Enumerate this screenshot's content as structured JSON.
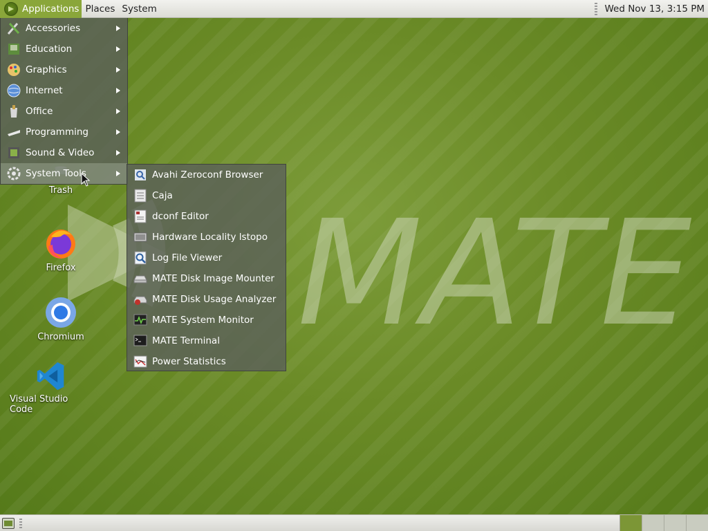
{
  "top_panel": {
    "menus": [
      "Applications",
      "Places",
      "System"
    ],
    "clock": "Wed Nov 13,  3:15 PM"
  },
  "desktop": {
    "logo_text": "MATE",
    "icons": [
      {
        "label": "Trash",
        "icon": "trash-icon"
      },
      {
        "label": "Firefox",
        "icon": "firefox-icon"
      },
      {
        "label": "Chromium",
        "icon": "chromium-icon"
      },
      {
        "label": "Visual Studio Code",
        "icon": "vscode-icon"
      }
    ]
  },
  "applications_menu": {
    "items": [
      {
        "label": "Accessories",
        "icon": "accessories-icon"
      },
      {
        "label": "Education",
        "icon": "education-icon"
      },
      {
        "label": "Graphics",
        "icon": "graphics-icon"
      },
      {
        "label": "Internet",
        "icon": "internet-icon"
      },
      {
        "label": "Office",
        "icon": "office-icon"
      },
      {
        "label": "Programming",
        "icon": "programming-icon"
      },
      {
        "label": "Sound & Video",
        "icon": "sound-video-icon"
      },
      {
        "label": "System Tools",
        "icon": "system-tools-icon",
        "selected": true
      }
    ]
  },
  "system_tools_menu": {
    "items": [
      {
        "label": "Avahi Zeroconf Browser",
        "icon": "avahi-icon"
      },
      {
        "label": "Caja",
        "icon": "file-manager-icon"
      },
      {
        "label": "dconf Editor",
        "icon": "dconf-icon"
      },
      {
        "label": "Hardware Locality lstopo",
        "icon": "hardware-icon"
      },
      {
        "label": "Log File Viewer",
        "icon": "log-viewer-icon"
      },
      {
        "label": "MATE Disk Image Mounter",
        "icon": "disk-mounter-icon"
      },
      {
        "label": "MATE Disk Usage Analyzer",
        "icon": "disk-usage-icon"
      },
      {
        "label": "MATE System Monitor",
        "icon": "system-monitor-icon"
      },
      {
        "label": "MATE Terminal",
        "icon": "terminal-icon"
      },
      {
        "label": "Power Statistics",
        "icon": "power-statistics-icon"
      }
    ]
  },
  "colors": {
    "accent": "#8aa63a",
    "desktop": "#6d8c2c",
    "menu_bg": "#5c6258"
  }
}
